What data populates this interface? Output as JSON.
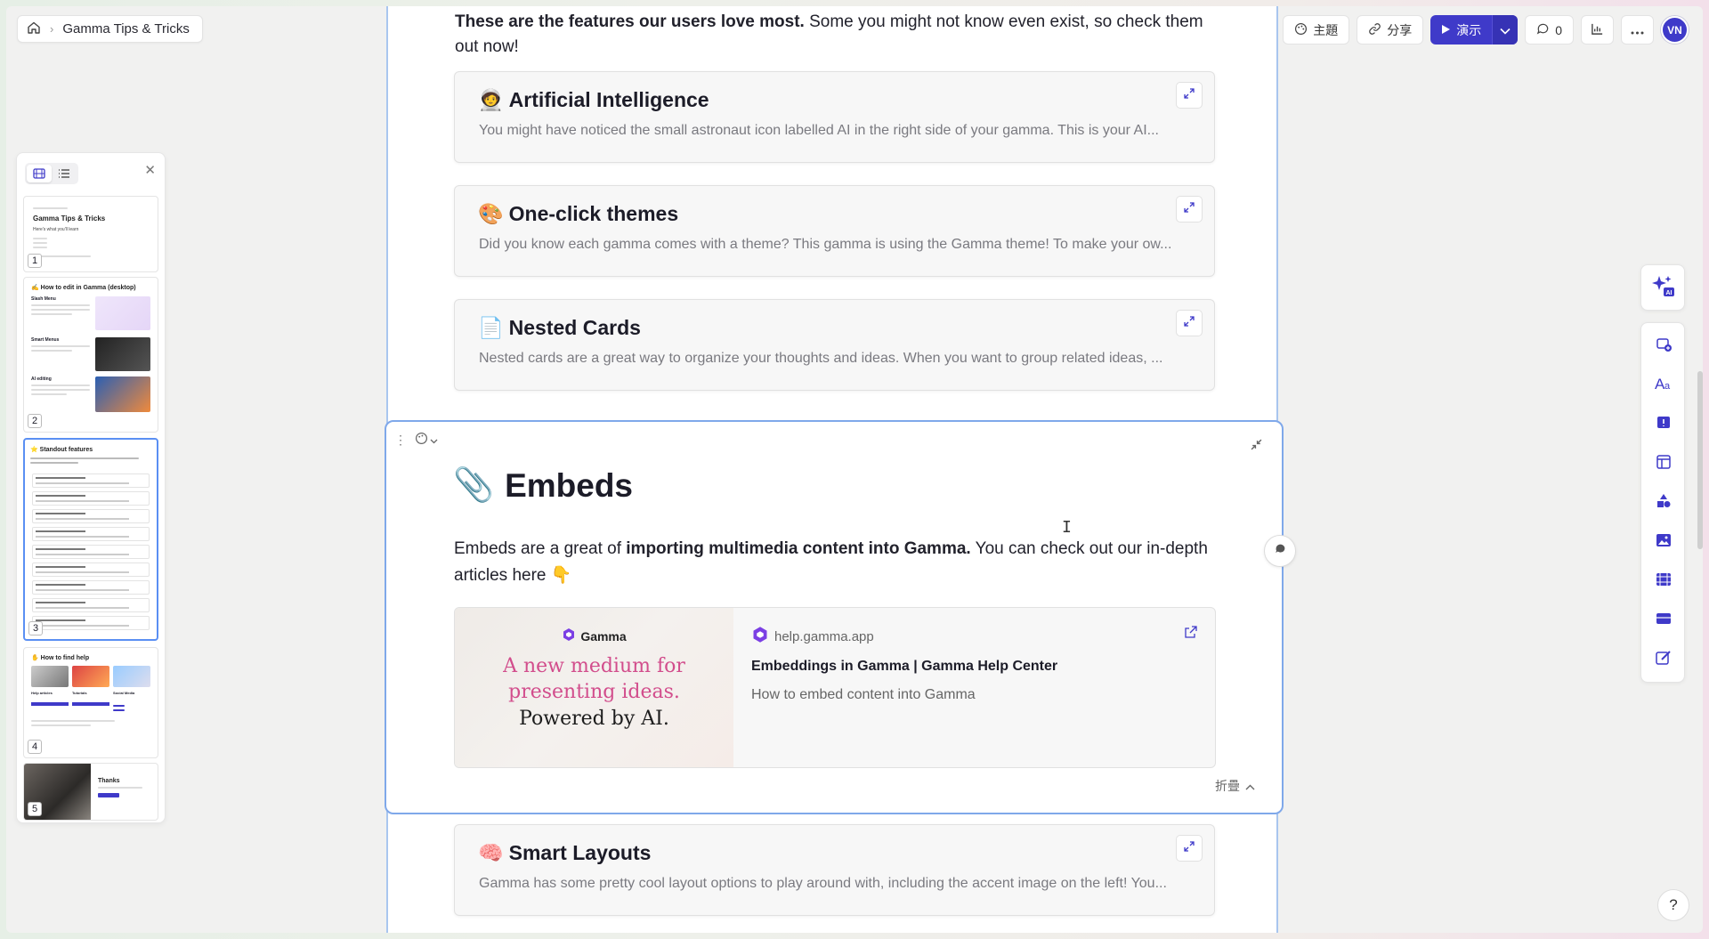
{
  "breadcrumb": {
    "title": "Gamma Tips & Tricks"
  },
  "toolbar": {
    "theme_label": "主題",
    "share_label": "分享",
    "present_label": "演示",
    "comments_count": "0",
    "avatar_initials": "VN"
  },
  "thumbnails": [
    {
      "num": "1",
      "title": "Gamma Tips & Tricks",
      "subtitle": "Here's what you'll learn"
    },
    {
      "num": "2",
      "title": "✍️ How to edit in Gamma (desktop)",
      "items": [
        "Slash Menu",
        "Smart Menus",
        "AI editing"
      ]
    },
    {
      "num": "3",
      "title": "⭐ Standout features",
      "items": [
        "Artificial Intelligence",
        "One-click themes",
        "Nested Cards",
        "Embeds",
        "Smart Layouts",
        "Present mode",
        "Sporting features",
        "Built in analytics",
        "Export to PDF & PPT",
        "AI Image Generation"
      ]
    },
    {
      "num": "4",
      "title": "✋ How to find help",
      "items": [
        "Help articles",
        "Tutorials",
        "Social Media"
      ]
    },
    {
      "num": "5",
      "title": "Thanks"
    }
  ],
  "intro": {
    "bold": "These are the features our users love most.",
    "rest": " Some you might not know even exist, so check them out now!"
  },
  "cards": [
    {
      "emoji": "🧑‍🚀",
      "title": "Artificial Intelligence",
      "desc": "You might have noticed the small astronaut icon labelled AI in the right side of your gamma. This is your AI..."
    },
    {
      "emoji": "🎨",
      "title": "One-click themes",
      "desc": "Did you know each gamma comes with a theme? This gamma is using the Gamma theme! To make your ow..."
    },
    {
      "emoji": "📄",
      "title": "Nested Cards",
      "desc": "Nested cards are a great way to organize your thoughts and ideas. When you want to group related ideas, ..."
    }
  ],
  "embeds": {
    "emoji": "📎",
    "title": "Embeds",
    "body_1": "Embeds are a great of ",
    "body_bold": "importing multimedia content into Gamma.",
    "body_2": " You can check out our in-depth articles here 👇",
    "link": {
      "brand": "Gamma",
      "headline_line1": "A new medium for",
      "headline_line2": "presenting ideas.",
      "headline_line3": "Powered by AI.",
      "domain": "help.gamma.app",
      "title": "Embeddings in Gamma | Gamma Help Center",
      "desc": "How to embed content into Gamma"
    },
    "fold_label": "折疊"
  },
  "bottom_card": {
    "emoji": "🧠",
    "title": "Smart Layouts",
    "desc": "Gamma has some pretty cool layout options to play around with, including the accent image on the left! You..."
  },
  "help_label": "?",
  "colors": {
    "accent": "#3f3ac9",
    "selection": "#7fa8ea"
  }
}
